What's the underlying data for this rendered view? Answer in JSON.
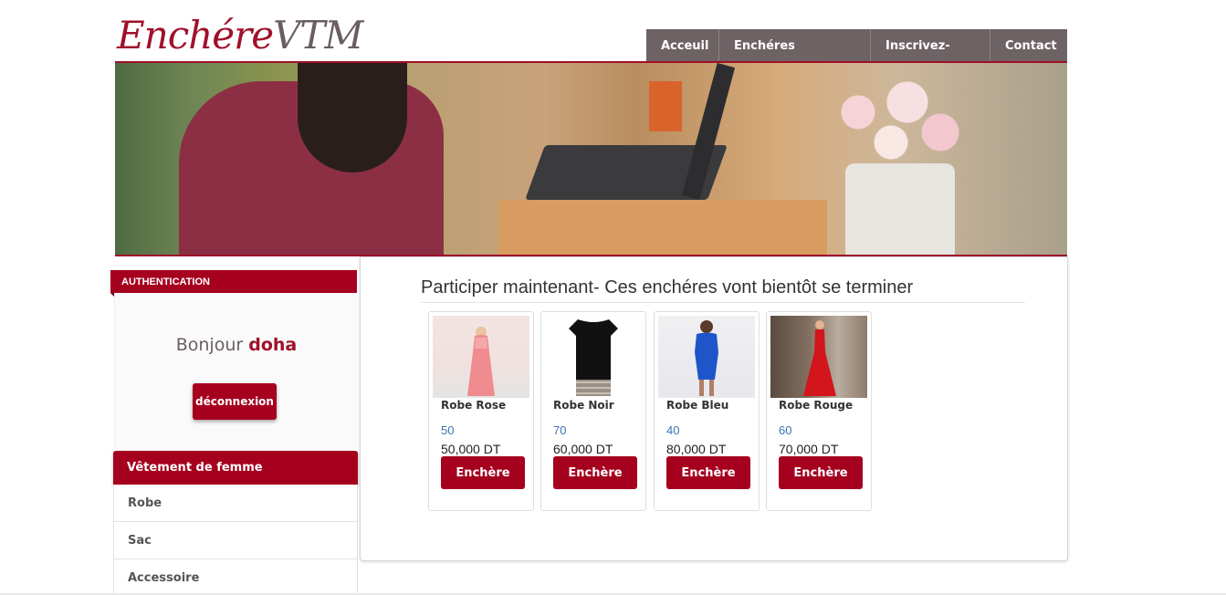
{
  "logo": {
    "part1": "Enchére",
    "part2": "VTM"
  },
  "nav": [
    {
      "label": "Acceuil"
    },
    {
      "label": "Enchéres terminées"
    },
    {
      "label": "Inscrivez-vous"
    },
    {
      "label": "Contact"
    }
  ],
  "auth": {
    "header": "AUTHENTICATION",
    "greeting": "Bonjour",
    "username": "doha",
    "logout_label": "déconnexion"
  },
  "categories": {
    "header": "Vêtement de femme",
    "items": [
      "Robe",
      "Sac",
      "Accessoire"
    ]
  },
  "main": {
    "title": "Participer maintenant- Ces enchéres vont bientôt se terminer",
    "products": [
      {
        "name": "Robe Rose",
        "price": "50",
        "amount": "50,000 DT",
        "button": "Enchère"
      },
      {
        "name": "Robe Noir",
        "price": "70",
        "amount": "60,000 DT",
        "button": "Enchère"
      },
      {
        "name": "Robe Bleu",
        "price": "40",
        "amount": "80,000 DT",
        "button": "Enchère"
      },
      {
        "name": "Robe Rouge",
        "price": "60",
        "amount": "70,000 DT",
        "button": "Enchère"
      }
    ]
  },
  "colors": {
    "accent": "#a6001f",
    "nav_bg": "#6e6364",
    "link_blue": "#3a72b5"
  }
}
